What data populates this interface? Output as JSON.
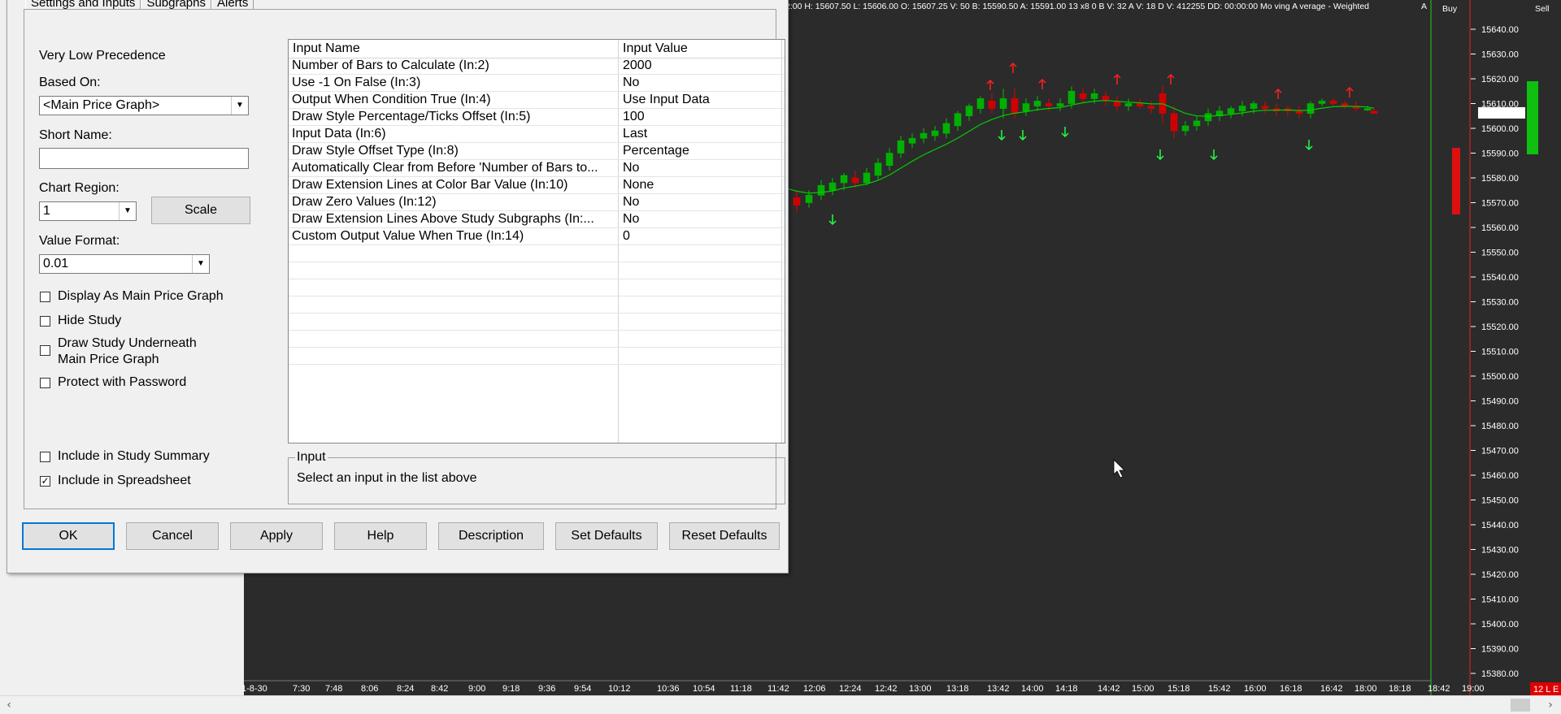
{
  "dialog": {
    "tabs": [
      "Settings and Inputs",
      "Subgraphs",
      "Alerts"
    ],
    "precedence": "Very Low Precedence",
    "based_on_label": "Based On:",
    "based_on_value": "<Main Price Graph>",
    "short_name_label": "Short Name:",
    "short_name_value": "",
    "chart_region_label": "Chart Region:",
    "chart_region_value": "1",
    "scale_button": "Scale",
    "value_format_label": "Value Format:",
    "value_format_value": "0.01",
    "checkboxes": [
      {
        "label": "Display As Main Price Graph",
        "checked": false
      },
      {
        "label": "Hide Study",
        "checked": false
      },
      {
        "label": "Draw Study Underneath",
        "label2": "Main Price Graph",
        "checked": false
      },
      {
        "label": "Protect with Password",
        "checked": false
      },
      {
        "label": "Include in Study Summary",
        "checked": false
      },
      {
        "label": "Include in Spreadsheet",
        "checked": true
      }
    ],
    "grid": {
      "col_name": "Input Name",
      "col_value": "Input Value",
      "rows": [
        {
          "name": "Number of Bars to Calculate   (In:2)",
          "value": "2000"
        },
        {
          "name": "Use -1 On False   (In:3)",
          "value": "No"
        },
        {
          "name": "Output When Condition True   (In:4)",
          "value": "Use Input Data"
        },
        {
          "name": "Draw Style Percentage/Ticks Offset   (In:5)",
          "value": "100"
        },
        {
          "name": "Input Data   (In:6)",
          "value": "Last"
        },
        {
          "name": "Draw Style Offset Type   (In:8)",
          "value": "Percentage"
        },
        {
          "name": "Automatically Clear from Before 'Number of Bars to...",
          "value": "No"
        },
        {
          "name": "Draw Extension Lines at Color Bar Value   (In:10)",
          "value": "None"
        },
        {
          "name": "Draw Zero Values   (In:12)",
          "value": "No"
        },
        {
          "name": "Draw Extension Lines Above Study Subgraphs   (In:...",
          "value": "No"
        },
        {
          "name": "Custom Output Value When True   (In:14)",
          "value": "0"
        }
      ]
    },
    "input_group_label": "Input",
    "input_group_text": "Select an input in the list above",
    "buttons": {
      "ok": "OK",
      "cancel": "Cancel",
      "apply": "Apply",
      "help": "Help",
      "description": "Description",
      "set_defaults": "Set Defaults",
      "reset_defaults": "Reset Defaults"
    }
  },
  "chart": {
    "header": "2:00 H: 15607.50 L: 15606.00 O: 15607.25 V: 50 B: 15590.50  A: 15591.00 13 x8 0 B V: 32  A V: 18 D V: 412255 DD: 00:00:00 Mo ving  A verage -  Weighted",
    "header_tail": "A",
    "buy_label": "Buy",
    "sell_label": "Sell",
    "price_labels": [
      "15640.00",
      "15630.00",
      "15620.00",
      "15610.00",
      "15600.00",
      "15590.00",
      "15580.00",
      "15570.00",
      "15560.00",
      "15550.00",
      "15540.00",
      "15530.00",
      "15520.00",
      "15510.00",
      "15500.00",
      "15490.00",
      "15480.00",
      "15470.00",
      "15460.00",
      "15450.00",
      "15440.00",
      "15430.00",
      "15420.00",
      "15410.00",
      "15400.00",
      "15390.00",
      "15380.00"
    ],
    "current_price": "15606.25",
    "time_labels": [
      "1-8-30",
      "7:30",
      "7:48",
      "8:06",
      "8:24",
      "8:42",
      "9:00",
      "9:18",
      "9:36",
      "9:54",
      "10:12",
      "10:36",
      "10:54",
      "11:18",
      "11:42",
      "12:06",
      "12:24",
      "12:42",
      "13:00",
      "13:18",
      "13:42",
      "14:00",
      "14:18",
      "14:42",
      "15:00",
      "15:18",
      "15:42",
      "16:00",
      "16:18",
      "16:42",
      "18:00",
      "18:18",
      "18:42",
      "19:00"
    ],
    "bottom_right_badge": "12 L E",
    "colors": {
      "background": "#2b2b2b",
      "up": "#00c000",
      "down": "#e00000",
      "ma": "#00d000",
      "up_arrow": "#22ff44",
      "down_arrow": "#ff2020"
    }
  }
}
